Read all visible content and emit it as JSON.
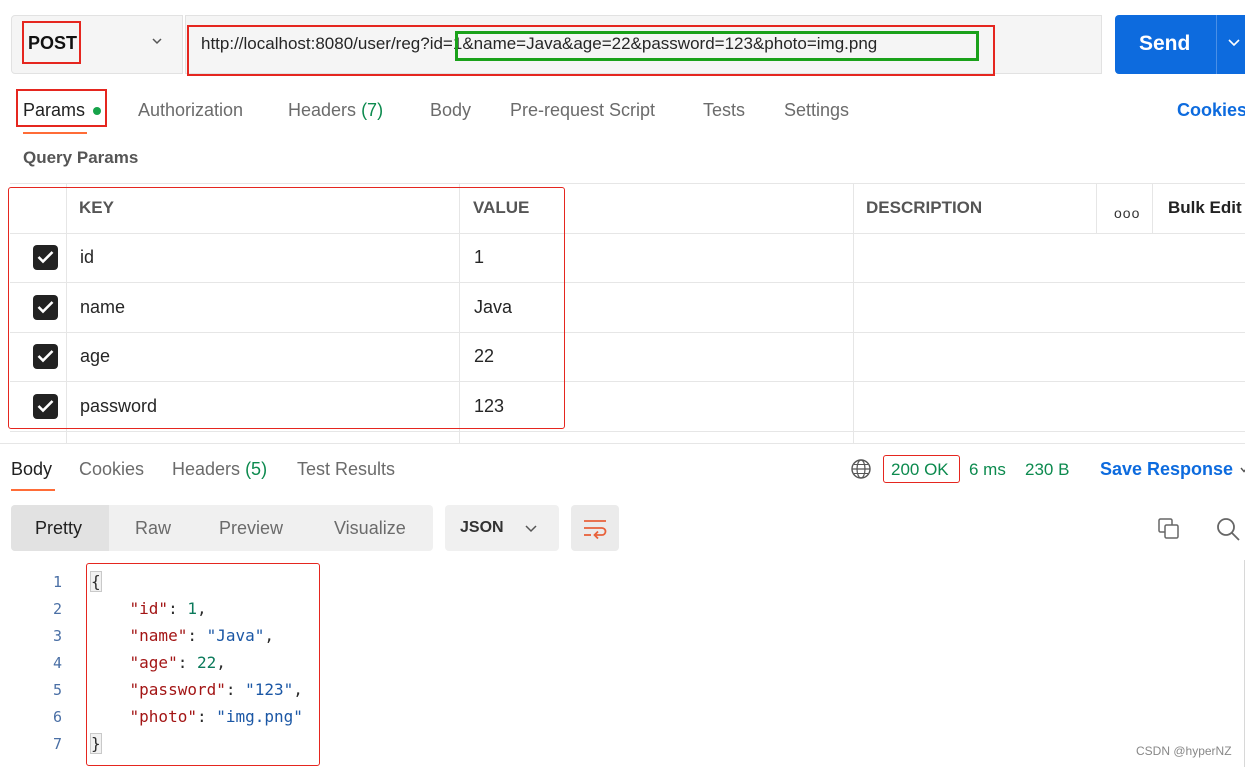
{
  "request": {
    "method": "POST",
    "url": "http://localhost:8080/user/reg?id=1&name=Java&age=22&password=123&photo=img.png",
    "send_label": "Send"
  },
  "request_tabs": [
    {
      "label": "Params",
      "active": true
    },
    {
      "label": "Authorization"
    },
    {
      "label": "Headers",
      "count": "(7)"
    },
    {
      "label": "Body"
    },
    {
      "label": "Pre-request Script"
    },
    {
      "label": "Tests"
    },
    {
      "label": "Settings"
    }
  ],
  "cookies_link": "Cookies",
  "query_params": {
    "section_label": "Query Params",
    "headers": {
      "key": "KEY",
      "value": "VALUE",
      "description": "DESCRIPTION",
      "more": "ooo",
      "bulk_edit": "Bulk Edit"
    },
    "rows": [
      {
        "checked": true,
        "key": "id",
        "value": "1"
      },
      {
        "checked": true,
        "key": "name",
        "value": "Java"
      },
      {
        "checked": true,
        "key": "age",
        "value": "22"
      },
      {
        "checked": true,
        "key": "password",
        "value": "123"
      }
    ]
  },
  "response": {
    "tabs": [
      {
        "label": "Body",
        "active": true
      },
      {
        "label": "Cookies"
      },
      {
        "label": "Headers",
        "count": "(5)"
      },
      {
        "label": "Test Results"
      }
    ],
    "status": "200 OK",
    "time": "6 ms",
    "size": "230 B",
    "save_label": "Save Response",
    "views": [
      "Pretty",
      "Raw",
      "Preview",
      "Visualize"
    ],
    "active_view": "Pretty",
    "format": "JSON",
    "code_lines": [
      {
        "n": "1",
        "text": "{"
      },
      {
        "n": "2",
        "text": "    \"id\": 1,"
      },
      {
        "n": "3",
        "text": "    \"name\": \"Java\","
      },
      {
        "n": "4",
        "text": "    \"age\": 22,"
      },
      {
        "n": "5",
        "text": "    \"password\": \"123\","
      },
      {
        "n": "6",
        "text": "    \"photo\": \"img.png\""
      },
      {
        "n": "7",
        "text": "}"
      }
    ]
  },
  "watermark": "CSDN @hyperNZ",
  "colors": {
    "send": "#0d6bde",
    "accent_underline": "#ff6c37",
    "status_green": "#0c8a4e",
    "annotation_red": "#e5261f",
    "annotation_green": "#1aa11a"
  }
}
